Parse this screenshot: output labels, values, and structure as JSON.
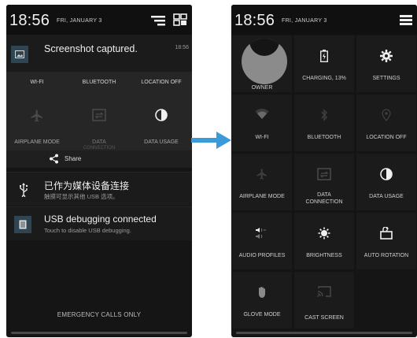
{
  "left": {
    "clock": "18:56",
    "date": "FRI, JANUARY 3",
    "screenshot_notification": {
      "title": "Screenshot captured.",
      "time": "18:56"
    },
    "quick_settings": {
      "top_labels": [
        "WI-FI",
        "BLUETOOTH",
        "LOCATION OFF"
      ],
      "bottom_labels": [
        "AIRPLANE MODE",
        "DATA",
        "DATA USAGE"
      ],
      "data_sub": "CONNECTION"
    },
    "share_label": "Share",
    "usb_notification": {
      "title": "已作为媒体设备连接",
      "subtitle": "触摸可显示其他 USB 选项。"
    },
    "debug_notification": {
      "title": "USB debugging connected",
      "subtitle": "Touch to disable USB debugging."
    },
    "emergency": "EMERGENCY CALLS ONLY"
  },
  "right": {
    "clock": "18:56",
    "date": "FRI, JANUARY 3",
    "tiles": [
      {
        "label": "OWNER",
        "icon": "avatar-icon"
      },
      {
        "label": "CHARGING, 13%",
        "icon": "battery-icon"
      },
      {
        "label": "SETTINGS",
        "icon": "gear-icon"
      },
      {
        "label": "WI-FI",
        "icon": "wifi-icon"
      },
      {
        "label": "BLUETOOTH",
        "icon": "bluetooth-icon"
      },
      {
        "label": "LOCATION OFF",
        "icon": "location-icon"
      },
      {
        "label": "AIRPLANE MODE",
        "icon": "airplane-icon"
      },
      {
        "label": "DATA\nCONNECTION",
        "icon": "data-icon"
      },
      {
        "label": "DATA USAGE",
        "icon": "pie-icon"
      },
      {
        "label": "AUDIO PROFILES",
        "icon": "audio-icon"
      },
      {
        "label": "BRIGHTNESS",
        "icon": "brightness-icon"
      },
      {
        "label": "AUTO ROTATION",
        "icon": "rotation-icon"
      },
      {
        "label": "GLOVE MODE",
        "icon": "glove-icon"
      },
      {
        "label": "CAST SCREEN",
        "icon": "cast-icon"
      }
    ]
  },
  "colors": {
    "accent_arrow": "#3a9bd8",
    "background": "#151515"
  }
}
